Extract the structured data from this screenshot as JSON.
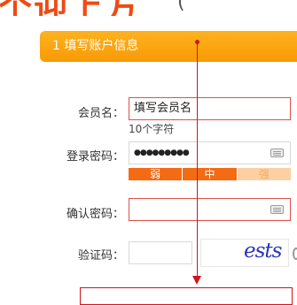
{
  "banner": {
    "fragment": "个迎上方",
    "paren": "("
  },
  "step": {
    "title": "1 填写账户信息"
  },
  "form": {
    "member_name": {
      "label": "会员名：",
      "value": "填写会员名",
      "hint": "10个字符"
    },
    "password": {
      "label": "登录密码：",
      "value": "●●●●●●●●●"
    },
    "strength": {
      "weak": "弱",
      "medium": "中",
      "strong": "强"
    },
    "confirm_password": {
      "label": "确认密码：",
      "value": ""
    },
    "captcha": {
      "label": "验证码：",
      "value": "",
      "image_text": "ests"
    }
  },
  "colors": {
    "accent": "#f89a06",
    "error_border": "#e0504a",
    "guide_red": "#d1141b"
  }
}
